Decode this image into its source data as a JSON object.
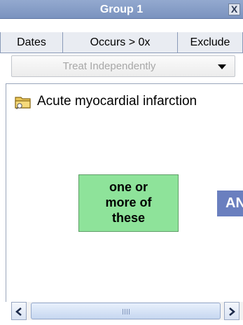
{
  "panel": {
    "title": "Group 1",
    "close_label": "X"
  },
  "tabs": [
    {
      "label": "Dates"
    },
    {
      "label": "Occurs > 0x"
    },
    {
      "label": "Exclude"
    }
  ],
  "dropdown": {
    "value": "Treat Independently"
  },
  "items": [
    {
      "label": "Acute myocardial infarction",
      "icon": "folder-icon"
    }
  ],
  "logic_box": {
    "line1": "one or",
    "line2": "more of",
    "line3": "these"
  },
  "operator": {
    "label": "AND"
  },
  "scrollbar": {
    "left_icon": "chevron-left-icon",
    "right_icon": "chevron-right-icon"
  },
  "colors": {
    "titlebar": "#8aa0c8",
    "logic_box": "#8ee39a",
    "operator": "#6a7fbf"
  }
}
